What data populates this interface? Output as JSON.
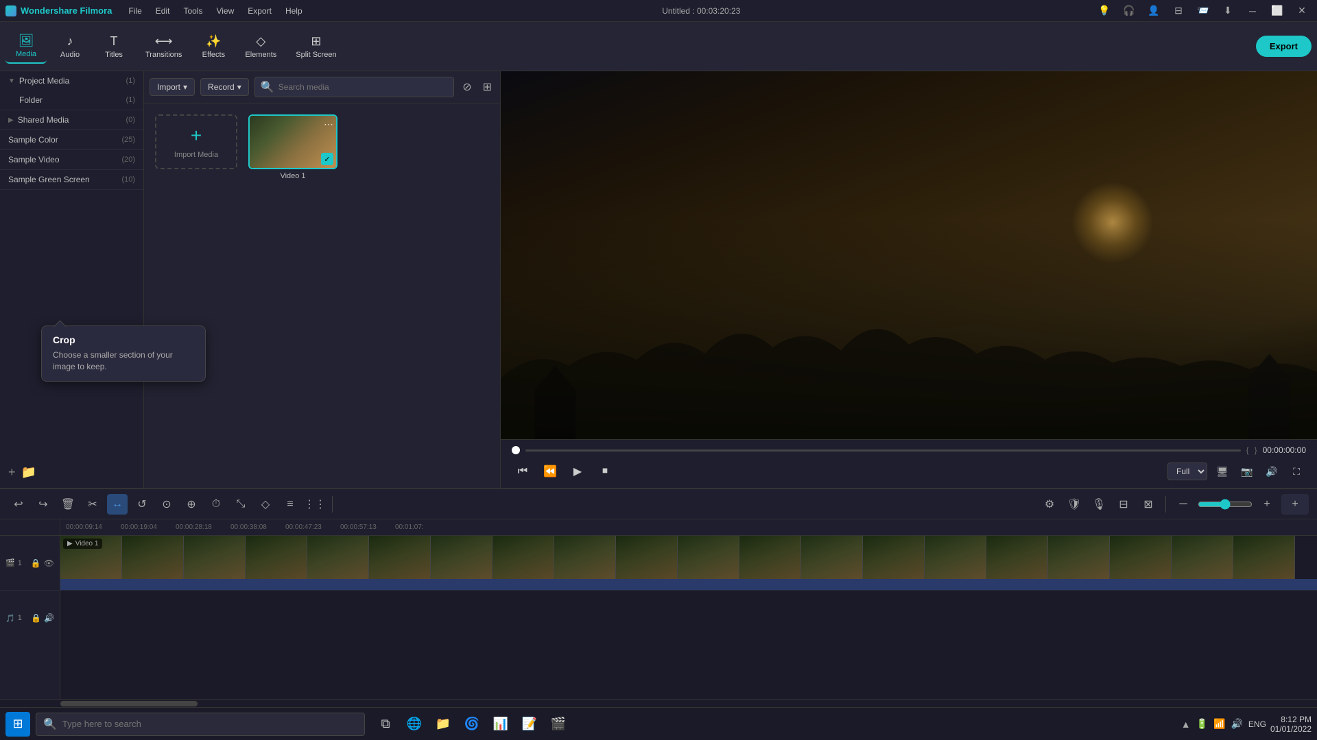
{
  "app": {
    "name": "Wondershare Filmora",
    "title": "Untitled : 00:03:20:23",
    "logo_symbol": "W"
  },
  "menu": {
    "items": [
      "File",
      "Edit",
      "Tools",
      "View",
      "Export",
      "Help"
    ]
  },
  "window_controls": {
    "minimize": "─",
    "maximize": "⬜",
    "close": "✕"
  },
  "toolbar": {
    "items": [
      {
        "id": "media",
        "label": "Media",
        "icon": "🖼",
        "active": true
      },
      {
        "id": "audio",
        "label": "Audio",
        "icon": "♪"
      },
      {
        "id": "titles",
        "label": "Titles",
        "icon": "T"
      },
      {
        "id": "transitions",
        "label": "Transitions",
        "icon": "⟷"
      },
      {
        "id": "effects",
        "label": "Effects",
        "icon": "✨"
      },
      {
        "id": "elements",
        "label": "Elements",
        "icon": "◇"
      },
      {
        "id": "split_screen",
        "label": "Split Screen",
        "icon": "⊞"
      }
    ],
    "export_label": "Export"
  },
  "sidebar": {
    "items": [
      {
        "label": "Project Media",
        "count": 1,
        "expanded": true,
        "level": 0
      },
      {
        "label": "Folder",
        "count": 1,
        "level": 1
      },
      {
        "label": "Shared Media",
        "count": 0,
        "level": 0
      },
      {
        "label": "Sample Color",
        "count": 25,
        "level": 0
      },
      {
        "label": "Sample Video",
        "count": 20,
        "level": 0
      },
      {
        "label": "Sample Green Screen",
        "count": 10,
        "level": 0
      }
    ]
  },
  "media_panel": {
    "import_label": "Import",
    "record_label": "Record",
    "search_placeholder": "Search media",
    "import_media_label": "Import Media",
    "video1_label": "Video 1"
  },
  "preview": {
    "time_display": "00:00:00:00",
    "quality": "Full",
    "progress_left_marker": "{",
    "progress_right_marker": "}"
  },
  "timeline": {
    "toolbar": {
      "tools": [
        "↩",
        "↪",
        "🗑",
        "✂",
        "↔",
        "↺",
        "⊙",
        "⊕",
        "⏱",
        "⤡",
        "◇",
        "≡",
        "⋮⋮"
      ]
    },
    "ruler_marks": [
      "00:00:09:14",
      "00:00:19:04",
      "00:00:28:18",
      "00:00:38:08",
      "00:00:47:23",
      "00:00:57:13",
      "00:01:07:"
    ],
    "tracks": [
      {
        "type": "video",
        "num": 1,
        "label": "Video 1"
      },
      {
        "type": "audio",
        "num": 1
      }
    ]
  },
  "crop_tooltip": {
    "title": "Crop",
    "description": "Choose a smaller section of your image to keep."
  },
  "taskbar": {
    "start_icon": "⊞",
    "search_placeholder": "Type here to search",
    "apps": [
      {
        "name": "task-view",
        "icon": "⧉"
      },
      {
        "name": "chrome",
        "icon": "🌐"
      },
      {
        "name": "file-explorer",
        "icon": "📁"
      },
      {
        "name": "edge",
        "icon": "🌀"
      },
      {
        "name": "excel",
        "icon": "📊"
      },
      {
        "name": "word",
        "icon": "📝"
      },
      {
        "name": "filmora-taskbar",
        "icon": "🎬"
      }
    ],
    "tray_icons": [
      "▲",
      "🔋",
      "📶",
      "🔊",
      "🇬🇧"
    ],
    "language": "ENG",
    "time": "8:12 PM",
    "date": "01/01/2022"
  }
}
